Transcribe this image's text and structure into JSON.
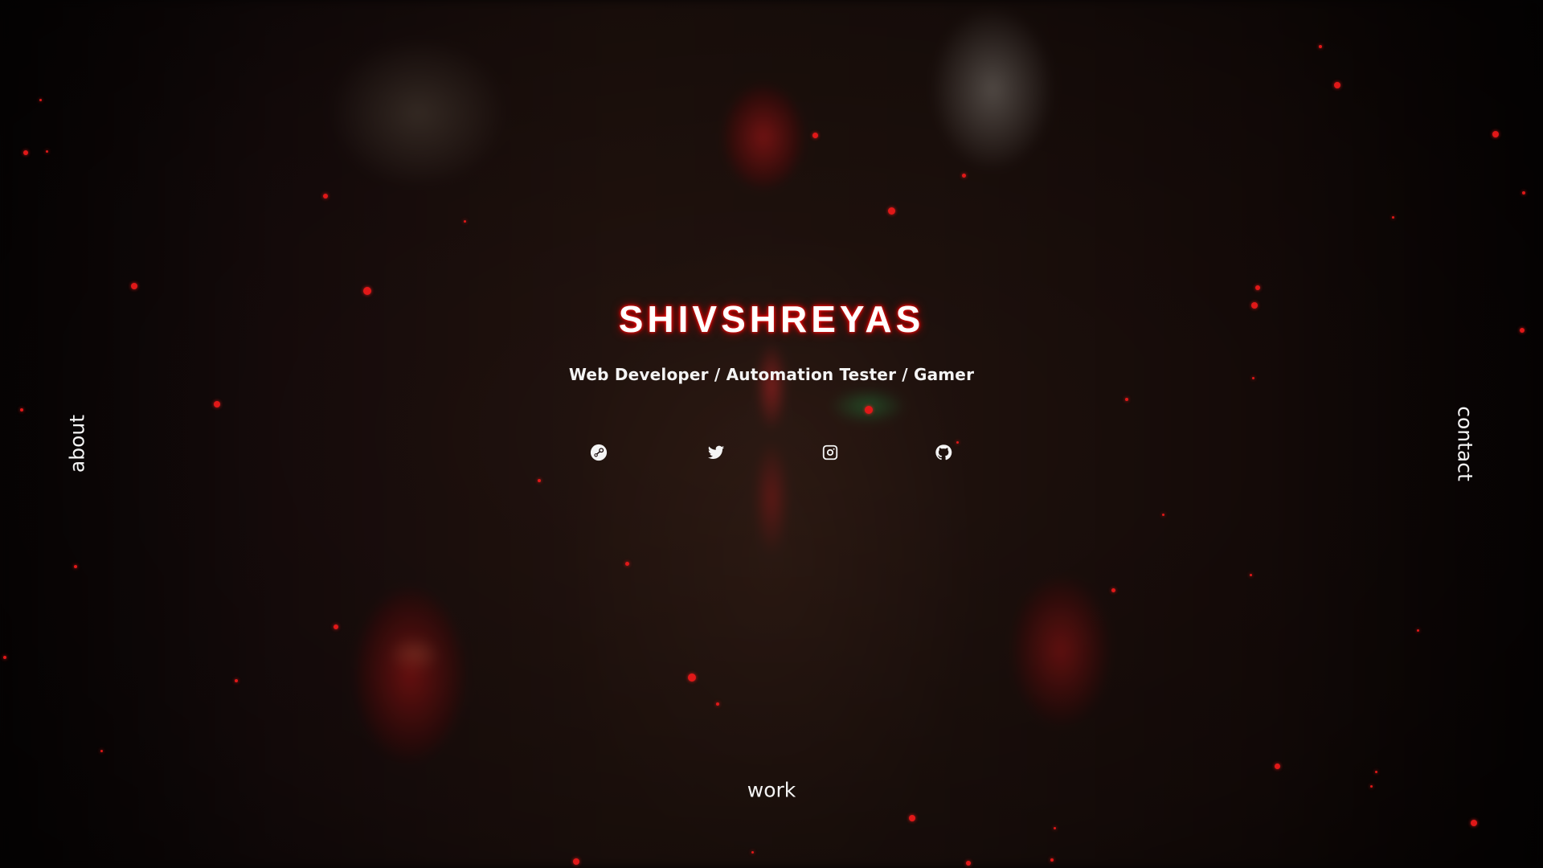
{
  "hero": {
    "title": "SHIVSHREYAS",
    "subtitle": "Web Developer / Automation Tester / Gamer"
  },
  "social_links": [
    {
      "name": "steam",
      "icon": "steam-icon"
    },
    {
      "name": "twitter",
      "icon": "twitter-icon"
    },
    {
      "name": "instagram",
      "icon": "instagram-icon"
    },
    {
      "name": "github",
      "icon": "github-icon"
    }
  ],
  "nav": {
    "about_label": "about",
    "contact_label": "contact",
    "work_label": "work"
  },
  "colors": {
    "title_glow": "#e00000",
    "particle": "#e01818",
    "text": "#f4f4f4"
  }
}
